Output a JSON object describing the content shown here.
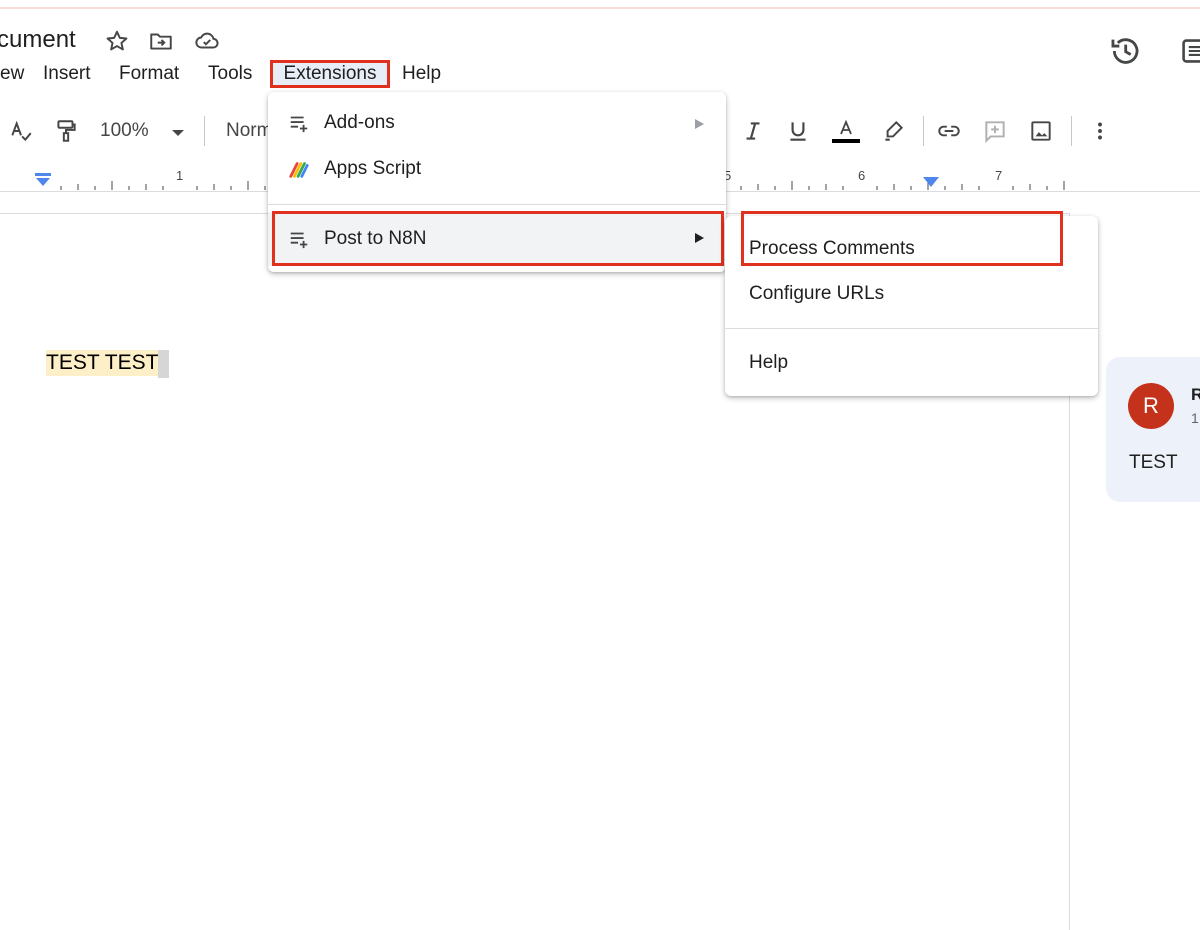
{
  "document": {
    "title": "cument",
    "body_text": "TEST TEST"
  },
  "menubar": {
    "view": "ew",
    "insert": "Insert",
    "format": "Format",
    "tools": "Tools",
    "extensions": "Extensions",
    "help": "Help"
  },
  "toolbar": {
    "zoom": "100%",
    "style": "Norm"
  },
  "ruler": {
    "numbers": [
      "1",
      "5",
      "6",
      "7"
    ]
  },
  "extensions_menu": {
    "items": [
      {
        "label": "Add-ons",
        "icon": "add-ons-icon",
        "has_submenu": true
      },
      {
        "label": "Apps Script",
        "icon": "apps-script-icon",
        "has_submenu": false
      },
      {
        "label": "Post to N8N",
        "icon": "post-to-n8n-icon",
        "has_submenu": true
      }
    ]
  },
  "submenu": {
    "items": [
      {
        "label": "Process Comments"
      },
      {
        "label": "Configure URLs"
      },
      {
        "label": "Help"
      }
    ]
  },
  "comment": {
    "avatar_letter": "R",
    "author": "R",
    "time": "1",
    "text": "TEST"
  },
  "colors": {
    "highlight_border": "#e0301e",
    "avatar": "#c5321b",
    "text_highlight": "#fdefc7"
  }
}
